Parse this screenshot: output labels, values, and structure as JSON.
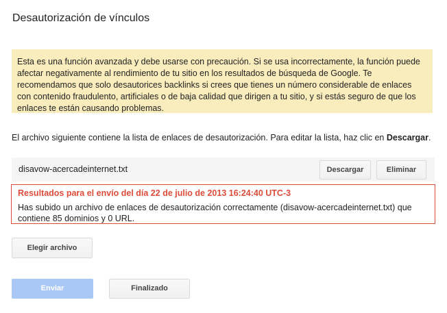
{
  "page": {
    "title": "Desautorización de vínculos"
  },
  "warning": {
    "text": "Esta es una función avanzada y debe usarse con precaución. Si se usa incorrectamente, la función puede afectar negativamente al rendimiento de tu sitio en los resultados de búsqueda de Google. Te recomendamos que solo desautorices backlinks si crees que tienes un número considerable de enlaces con contenido fraudulento, artificiales o de baja calidad que dirigen a tu sitio, y si estás seguro de que los enlaces te están causando problemas."
  },
  "description": {
    "text": "El archivo siguiente contiene la lista de enlaces de desautorización. Para editar la lista, haz clic en ",
    "bold_text": "Descargar",
    "suffix": "."
  },
  "file": {
    "name": "disavow-acercadeinternet.txt",
    "download_label": "Descargar",
    "delete_label": "Eliminar"
  },
  "result": {
    "heading": "Resultados para el envío del día 22 de julio de 2013 16:24:40 UTC-3",
    "message": "Has subido un archivo de enlaces de desautorización correctamente (disavow-acercadeinternet.txt) que contiene 85 dominios y 0 URL."
  },
  "actions": {
    "choose_file_label": "Elegir archivo",
    "send_label": "Enviar",
    "done_label": "Finalizado"
  },
  "colors": {
    "warning_background": "#f9edbe",
    "error_accent": "#dd4b39",
    "disabled_primary": "#a9c8f5"
  }
}
